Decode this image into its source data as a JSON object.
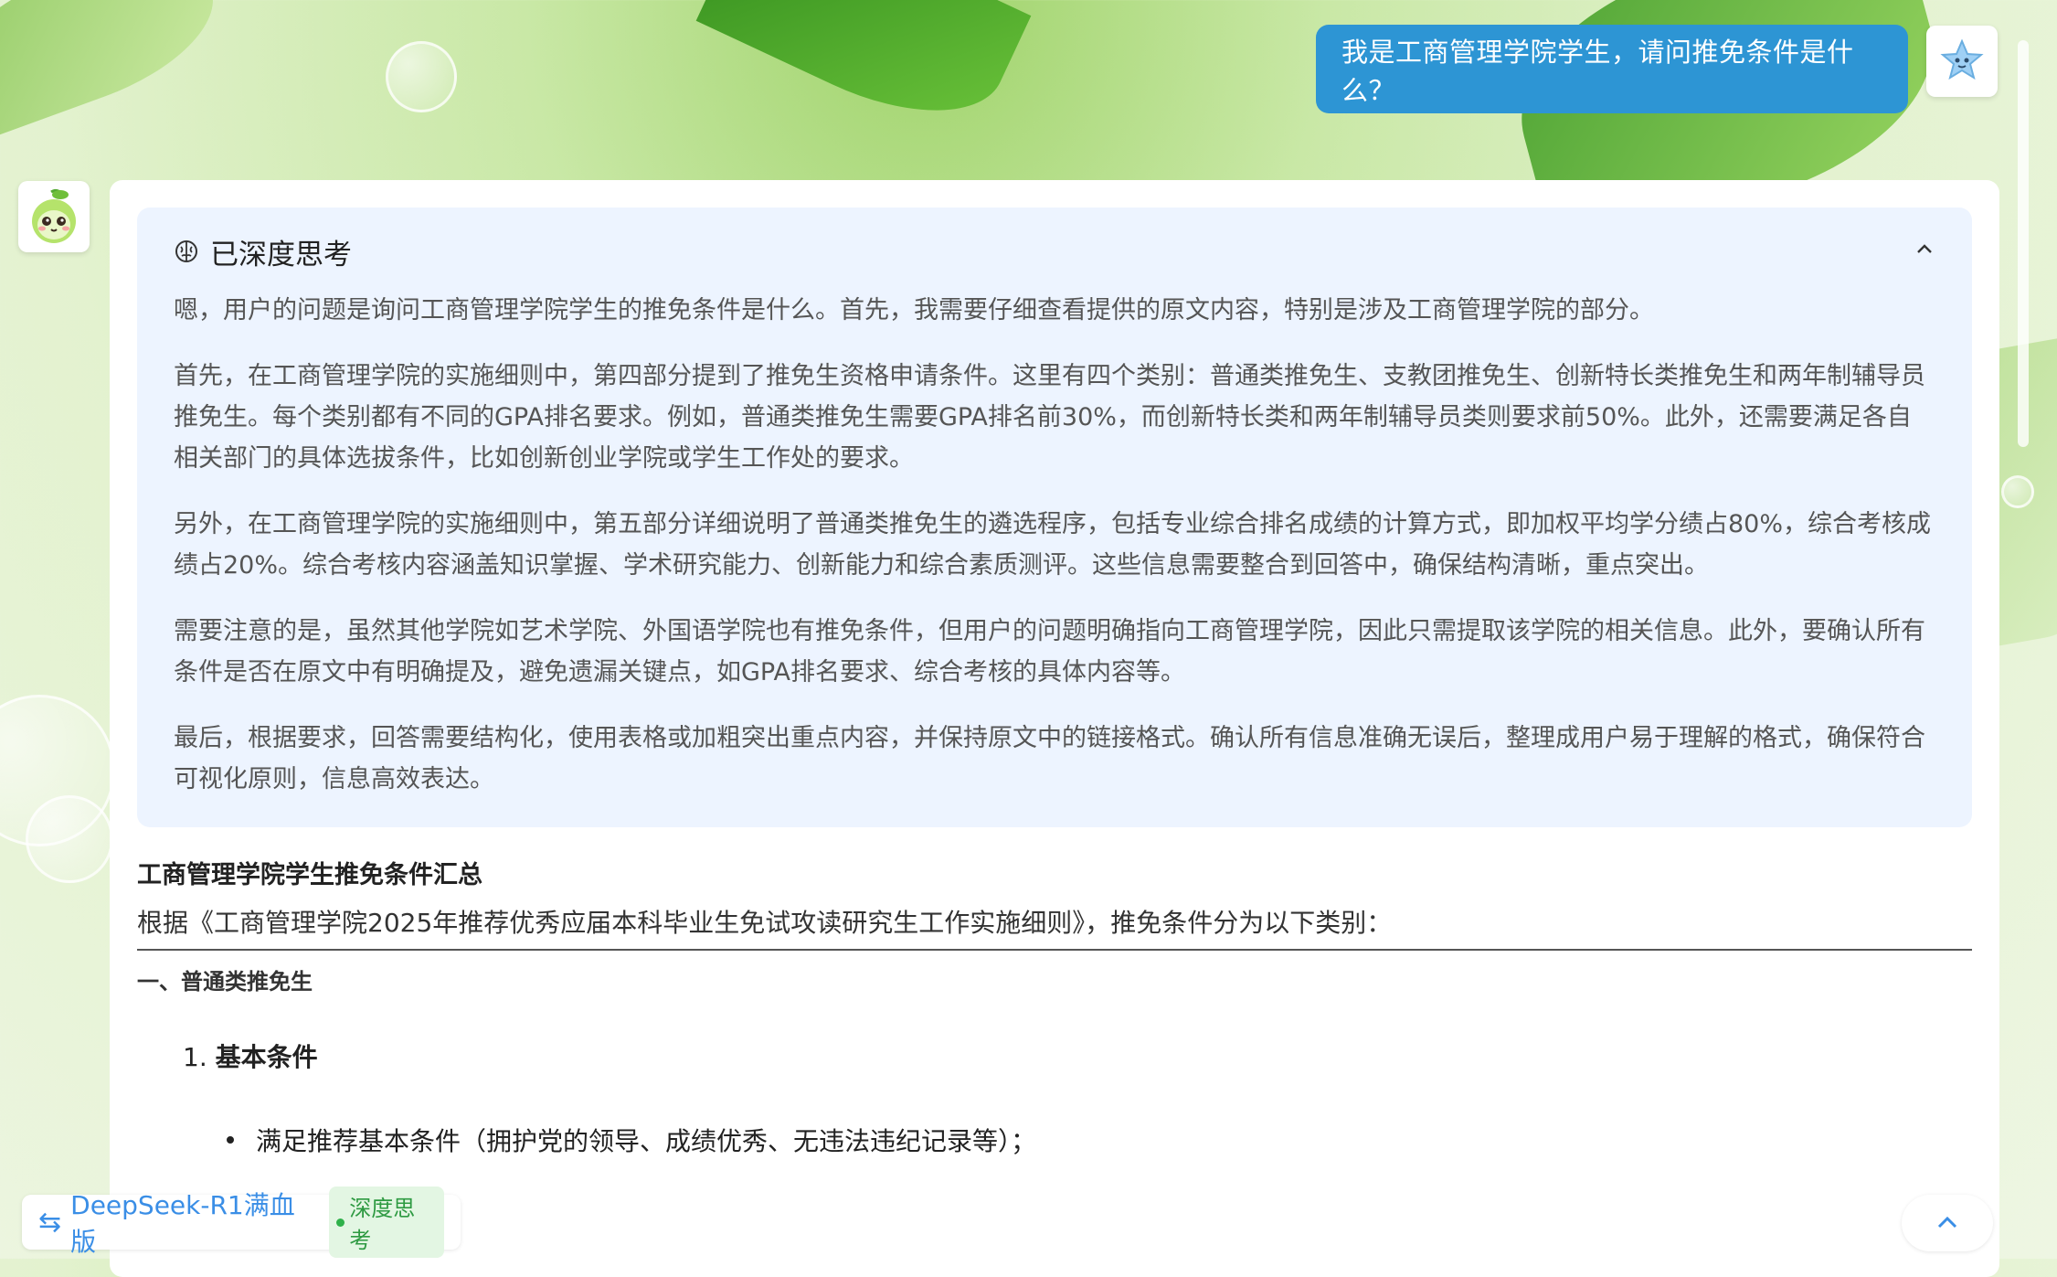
{
  "chat": {
    "user_message": "我是工商管理学院学生，请问推免条件是什么？",
    "thinking": {
      "title": "已深度思考",
      "paragraphs": [
        "嗯，用户的问题是询问工商管理学院学生的推免条件是什么。首先，我需要仔细查看提供的原文内容，特别是涉及工商管理学院的部分。",
        "首先，在工商管理学院的实施细则中，第四部分提到了推免生资格申请条件。这里有四个类别：普通类推免生、支教团推免生、创新特长类推免生和两年制辅导员推免生。每个类别都有不同的GPA排名要求。例如，普通类推免生需要GPA排名前30%，而创新特长类和两年制辅导员类则要求前50%。此外，还需要满足各自相关部门的具体选拔条件，比如创新创业学院或学生工作处的要求。",
        "另外，在工商管理学院的实施细则中，第五部分详细说明了普通类推免生的遴选程序，包括专业综合排名成绩的计算方式，即加权平均学分绩占80%，综合考核成绩占20%。综合考核内容涵盖知识掌握、学术研究能力、创新能力和综合素质测评。这些信息需要整合到回答中，确保结构清晰，重点突出。",
        "需要注意的是，虽然其他学院如艺术学院、外国语学院也有推免条件，但用户的问题明确指向工商管理学院，因此只需提取该学院的相关信息。此外，要确认所有条件是否在原文中有明确提及，避免遗漏关键点，如GPA排名要求、综合考核的具体内容等。",
        "最后，根据要求，回答需要结构化，使用表格或加粗突出重点内容，并保持原文中的链接格式。确认所有信息准确无误后，整理成用户易于理解的格式，确保符合可视化原则，信息高效表达。"
      ]
    },
    "answer": {
      "title": "工商管理学院学生推免条件汇总",
      "intro": "根据《工商管理学院2025年推荐优秀应届本科毕业生免试攻读研究生工作实施细则》，推免条件分为以下类别：",
      "section1": "一、普通类推免生",
      "sub1_num": "1.",
      "sub1_title": "基本条件",
      "bullet1": "满足推荐基本条件（拥护党的领导、成绩优秀、无违法违纪记录等）；"
    }
  },
  "footer": {
    "model_name": "DeepSeek-R1满血版",
    "deep_tag": "深度思考"
  },
  "colors": {
    "user_bubble": "#2d95d4",
    "think_bg": "#edf4ff",
    "accent": "#3a8ee6",
    "tag_green": "#2e9a42"
  }
}
